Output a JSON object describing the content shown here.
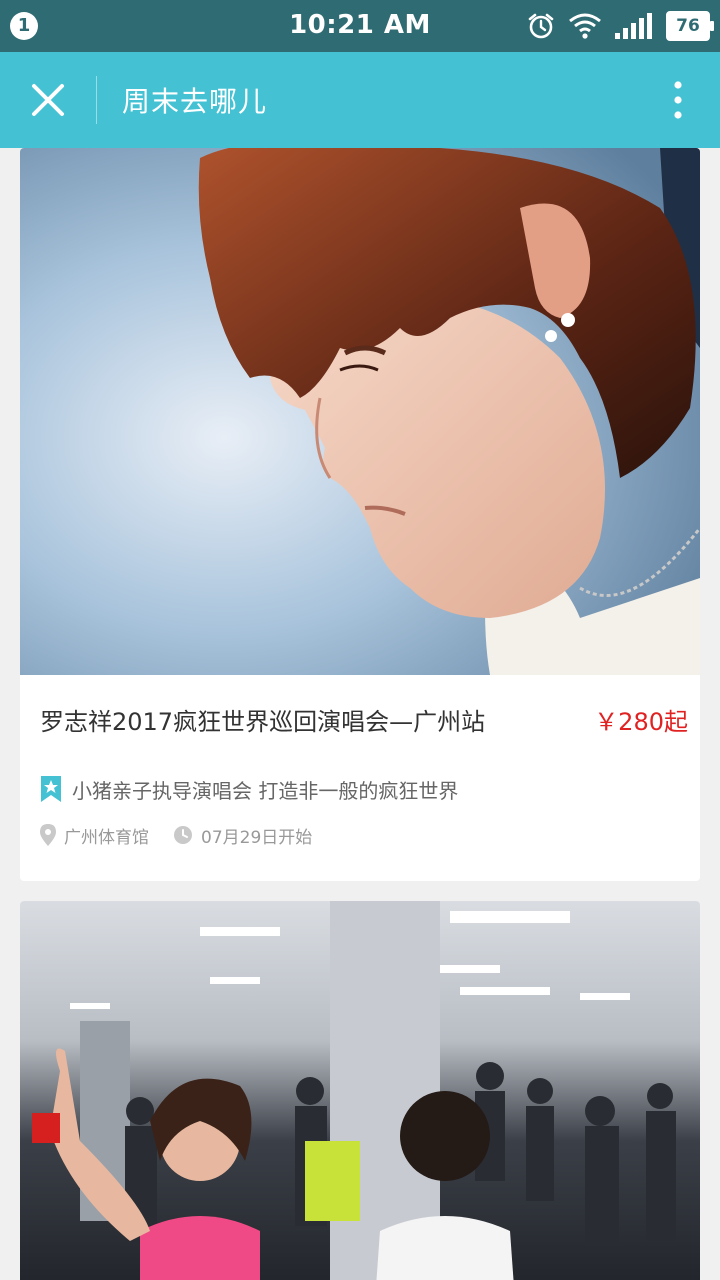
{
  "status_bar": {
    "notification_count": "1",
    "time": "10:21 AM",
    "battery": "76",
    "colors": {
      "background": "#2f6b73"
    }
  },
  "app_bar": {
    "title": "周末去哪儿",
    "close_icon": "close-icon",
    "more_icon": "more-vertical-icon",
    "colors": {
      "background": "#44c2d4"
    }
  },
  "events": [
    {
      "image": "concert-poster-photo",
      "title": "罗志祥2017疯狂世界巡回演唱会—广州站",
      "price": "￥280起",
      "tag_icon": "bookmark-star-icon",
      "tag_text": "小猪亲子执导演唱会 打造非一般的疯狂世界",
      "location_icon": "location-pin-icon",
      "location": "广州体育馆",
      "time_icon": "clock-icon",
      "start_date": "07月29日开始",
      "colors": {
        "price": "#e02222",
        "tag_icon": "#44c2d4"
      }
    },
    {
      "image": "dance-class-photo"
    }
  ]
}
